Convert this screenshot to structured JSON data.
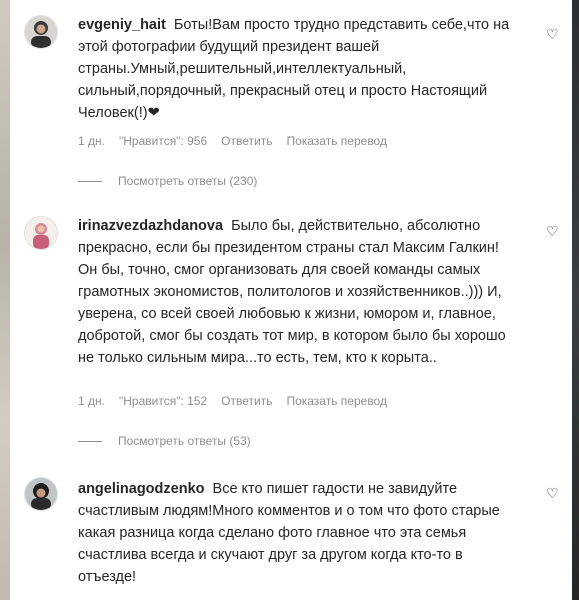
{
  "comments": [
    {
      "username": "evgeniy_hait",
      "text": "Боты!Вам просто трудно представить себе,что на этой фотографии будущий президент вашей страны.Умный,решительный,интеллектуальный, сильный,порядочный, прекрасный отец и просто Настоящий Человек(!)❤",
      "time": "1 дн.",
      "likes": "\"Нравится\": 956",
      "reply": "Ответить",
      "translate": "Показать перевод",
      "view_replies": "Посмотреть ответы (230)"
    },
    {
      "username": "irinazvezdazhdanova",
      "text": "Было бы, действительно, абсолютно прекрасно, если бы президентом страны стал Максим Галкин! Он бы, точно, смог организовать для своей команды самых грамотных экономистов, политологов и хозяйственников..))) И, уверена, со всей своей любовью к жизни, юмором и, главное, добротой, смог бы создать тот мир, в котором было бы хорошо не только сильным мира...то есть, тем, кто к корыта..",
      "time": "1 дн.",
      "likes": "\"Нравится\": 152",
      "reply": "Ответить",
      "translate": "Показать перевод",
      "view_replies": "Посмотреть ответы (53)"
    },
    {
      "username": "angelinagodzenko",
      "text": "Все кто пишет гадости не завидуйте счастливым людям!Много комментов и о том что фото старые какая разница когда сделано фото главное что эта семья счастлива всегда и скучают друг за другом когда кто-то в отъезде!"
    }
  ],
  "icons": {
    "like": "heart-outline-icon"
  }
}
